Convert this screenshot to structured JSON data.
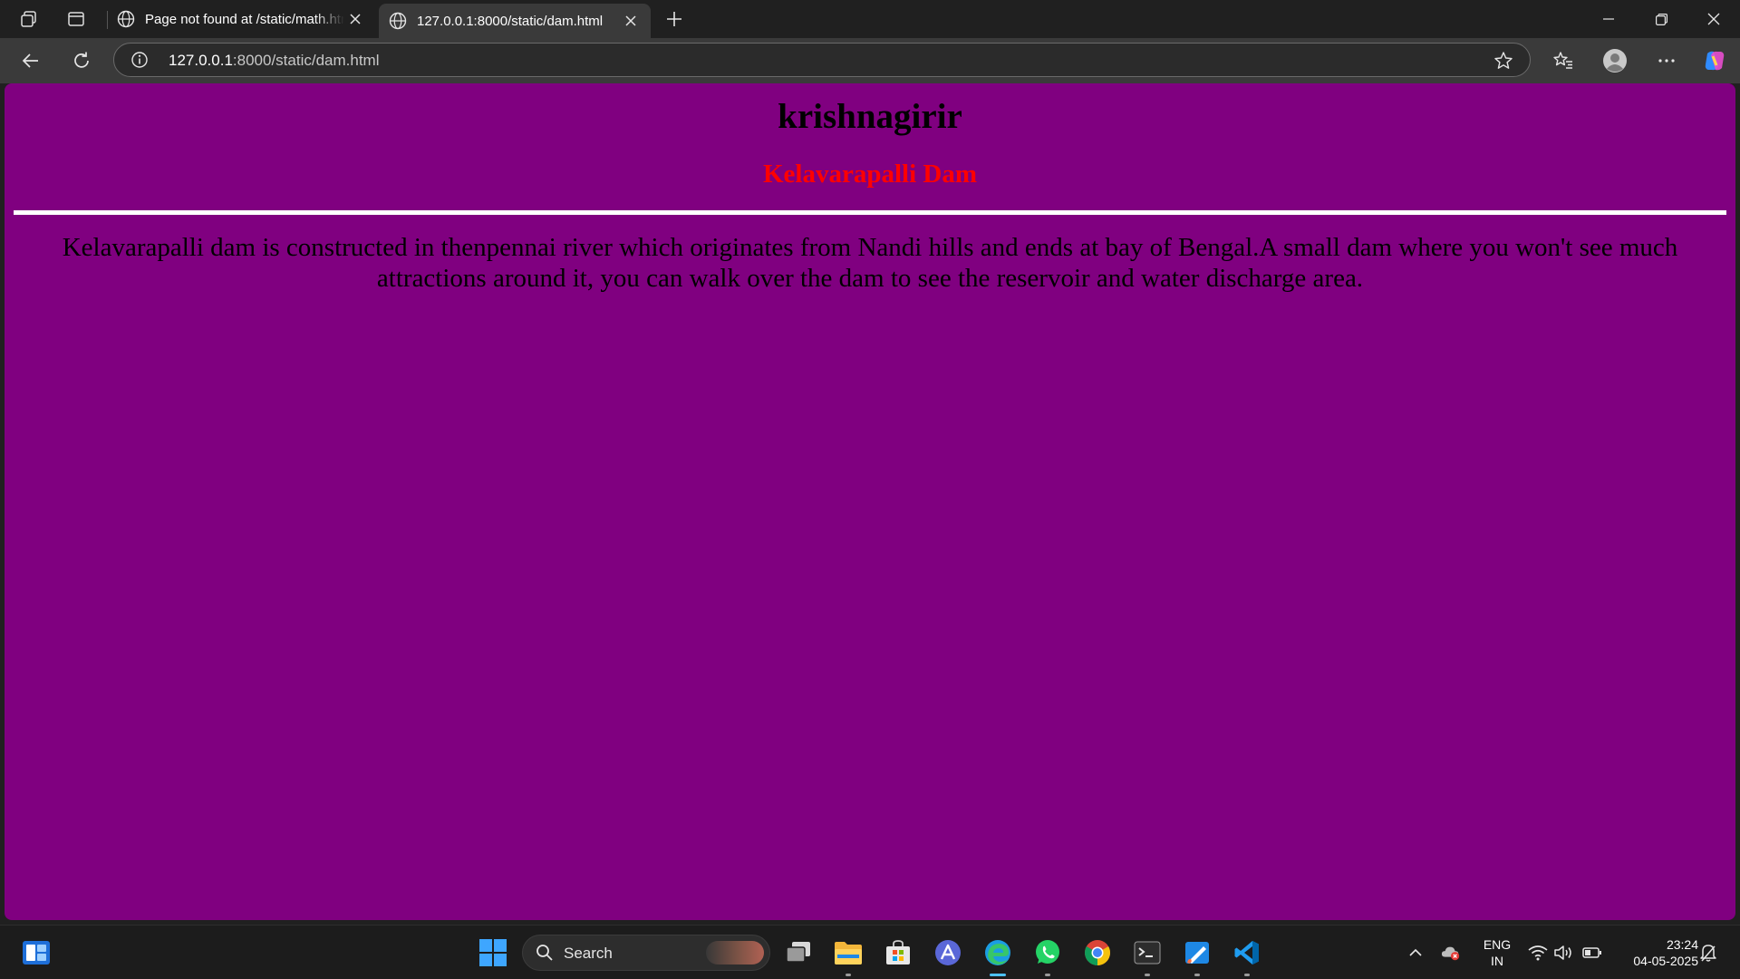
{
  "browser": {
    "tabs": [
      {
        "title": "Page not found at /static/math.html",
        "icon": "globe-icon",
        "active": false
      },
      {
        "title": "127.0.0.1:8000/static/dam.html",
        "icon": "globe-icon",
        "active": true
      }
    ],
    "address": {
      "host": "127.0.0.1",
      "path": ":8000/static/dam.html"
    }
  },
  "page": {
    "background": "#800080",
    "heading": "krishnagirir",
    "subheading": "Kelavarapalli Dam",
    "subheading_color": "#ff0000",
    "paragraph": "Kelavarapalli dam is constructed in thenpennai river which originates from Nandi hills and ends at bay of Bengal.A small dam where you won't see much attractions around it, you can walk over the dam to see the reservoir and water discharge area."
  },
  "taskbar": {
    "search_label": "Search",
    "apps": [
      "task-view",
      "file-explorer",
      "microsoft-store",
      "arc",
      "edge",
      "whatsapp",
      "chrome",
      "terminal",
      "paint",
      "vscode"
    ],
    "language": {
      "line1": "ENG",
      "line2": "IN"
    },
    "clock": {
      "time": "23:24",
      "date": "04-05-2025"
    }
  }
}
